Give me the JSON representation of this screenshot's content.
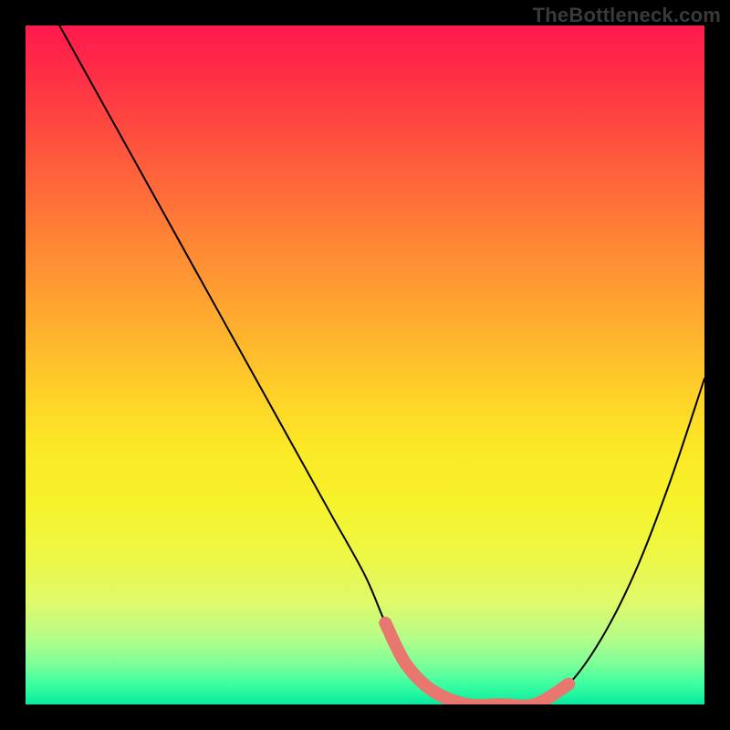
{
  "watermark": "TheBottleneck.com",
  "chart_data": {
    "type": "line",
    "title": "",
    "xlabel": "",
    "ylabel": "",
    "xlim": [
      0,
      100
    ],
    "ylim": [
      0,
      100
    ],
    "series": [
      {
        "name": "bottleneck-curve",
        "x": [
          5,
          10,
          15,
          20,
          25,
          30,
          35,
          40,
          45,
          50,
          53,
          56,
          60,
          65,
          70,
          75,
          80,
          85,
          90,
          95,
          100
        ],
        "values": [
          100,
          91,
          82,
          73,
          64,
          55,
          46,
          37,
          28,
          19,
          12,
          6,
          2,
          0,
          0,
          0,
          3,
          10,
          20,
          33,
          48
        ]
      }
    ],
    "highlight_segment": {
      "x_start": 53,
      "x_end": 80,
      "color": "#e7776f"
    },
    "gradient_stops": [
      {
        "pos": 0,
        "color": "#ff1a4d"
      },
      {
        "pos": 50,
        "color": "#ffd028"
      },
      {
        "pos": 80,
        "color": "#eef844"
      },
      {
        "pos": 100,
        "color": "#0ae5a0"
      }
    ]
  }
}
